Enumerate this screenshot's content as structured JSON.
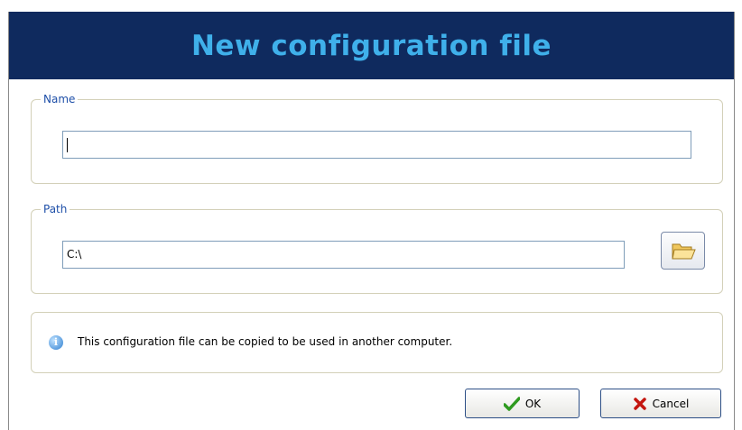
{
  "title": "New configuration file",
  "name_group": {
    "legend": "Name",
    "value": ""
  },
  "path_group": {
    "legend": "Path",
    "value": "C:\\"
  },
  "info": {
    "icon": "info-icon",
    "text": "This configuration file can be copied to be used in another computer."
  },
  "buttons": {
    "ok_label": "OK",
    "cancel_label": "Cancel"
  },
  "colors": {
    "title_bg": "#0f2a5e",
    "title_text": "#3fb0ea",
    "legend_text": "#1e4fa8"
  }
}
